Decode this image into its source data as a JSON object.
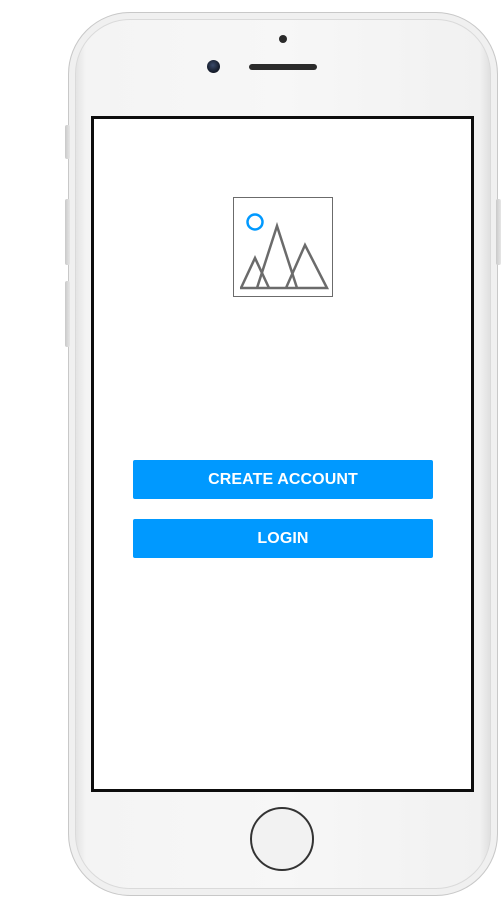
{
  "screen": {
    "buttons": {
      "create_account_label": "CREATE ACCOUNT",
      "login_label": "LOGIN"
    },
    "image_placeholder": {
      "icon": "image-placeholder-icon"
    }
  },
  "colors": {
    "accent": "#0099ff",
    "button_text": "#ffffff",
    "placeholder_stroke": "#6b6b6b"
  }
}
